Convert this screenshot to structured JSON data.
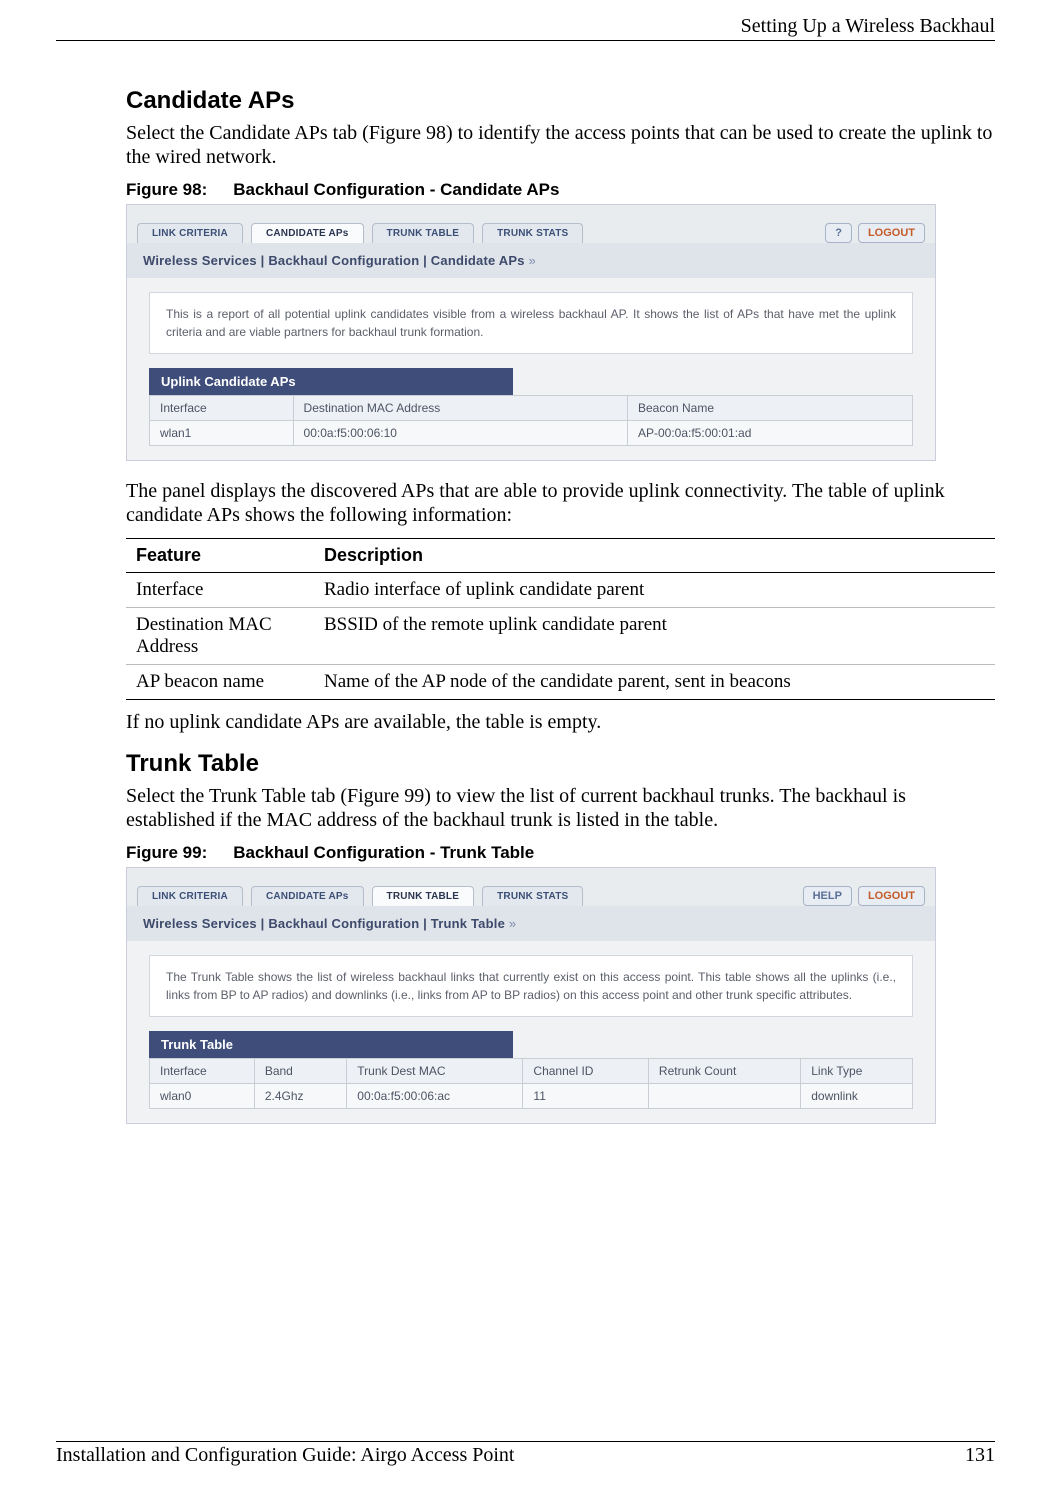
{
  "header": {
    "title": "Setting Up a Wireless Backhaul"
  },
  "section1": {
    "heading": "Candidate APs",
    "intro": "Select the Candidate APs tab (Figure 98) to identify the access points that can be used to create the uplink to the wired network.",
    "figure_label": "Figure 98:",
    "figure_title": "Backhaul Configuration - Candidate APs",
    "afterfig": "The panel displays the discovered APs that are able to provide uplink connectivity. The table of uplink candidate APs shows the following information:",
    "closing": "If no uplink candidate APs are available, the table is empty."
  },
  "screenshot1": {
    "tabs": [
      "LINK CRITERIA",
      "CANDIDATE APs",
      "TRUNK TABLE",
      "TRUNK STATS"
    ],
    "active_tab": 1,
    "help": "?",
    "logout": "LOGOUT",
    "breadcrumb": "Wireless Services | Backhaul Configuration | Candidate APs",
    "panel_text": "This is a report of all potential uplink candidates visible from a wireless backhaul AP. It shows the list of APs that have met the uplink criteria and are viable partners for backhaul trunk formation.",
    "section_label": "Uplink Candidate APs",
    "table": {
      "headers": [
        "Interface",
        "Destination MAC Address",
        "Beacon Name"
      ],
      "row": [
        "wlan1",
        "00:0a:f5:00:06:10",
        "AP-00:0a:f5:00:01:ad"
      ]
    }
  },
  "feature_table": {
    "headers": [
      "Feature",
      "Description"
    ],
    "rows": [
      [
        "Interface",
        "Radio interface of uplink candidate parent"
      ],
      [
        "Destination MAC Address",
        "BSSID of the remote uplink candidate parent"
      ],
      [
        "AP beacon name",
        "Name of the AP node of the candidate parent, sent in beacons"
      ]
    ]
  },
  "section2": {
    "heading": "Trunk Table",
    "intro": "Select the Trunk Table tab (Figure 99) to view the list of current backhaul trunks. The backhaul is established if the MAC address of the backhaul trunk is listed in the table.",
    "figure_label": "Figure 99:",
    "figure_title": "Backhaul Configuration - Trunk Table"
  },
  "screenshot2": {
    "tabs": [
      "LINK CRITERIA",
      "CANDIDATE APs",
      "TRUNK TABLE",
      "TRUNK STATS"
    ],
    "active_tab": 2,
    "help": "HELP",
    "logout": "LOGOUT",
    "breadcrumb": "Wireless Services | Backhaul Configuration | Trunk Table",
    "panel_text": "The Trunk Table shows the list of wireless backhaul links that currently exist on this access point. This table shows all the uplinks (i.e., links from BP to AP radios) and downlinks (i.e., links from AP to BP radios) on this access point and other trunk specific attributes.",
    "section_label": "Trunk Table",
    "table": {
      "headers": [
        "Interface",
        "Band",
        "Trunk Dest MAC",
        "Channel ID",
        "Retrunk Count",
        "Link Type"
      ],
      "row": [
        "wlan0",
        "2.4Ghz",
        "00:0a:f5:00:06:ac",
        "11",
        "",
        "downlink"
      ]
    }
  },
  "footer": {
    "left": "Installation and Configuration Guide: Airgo Access Point",
    "right": "131"
  }
}
